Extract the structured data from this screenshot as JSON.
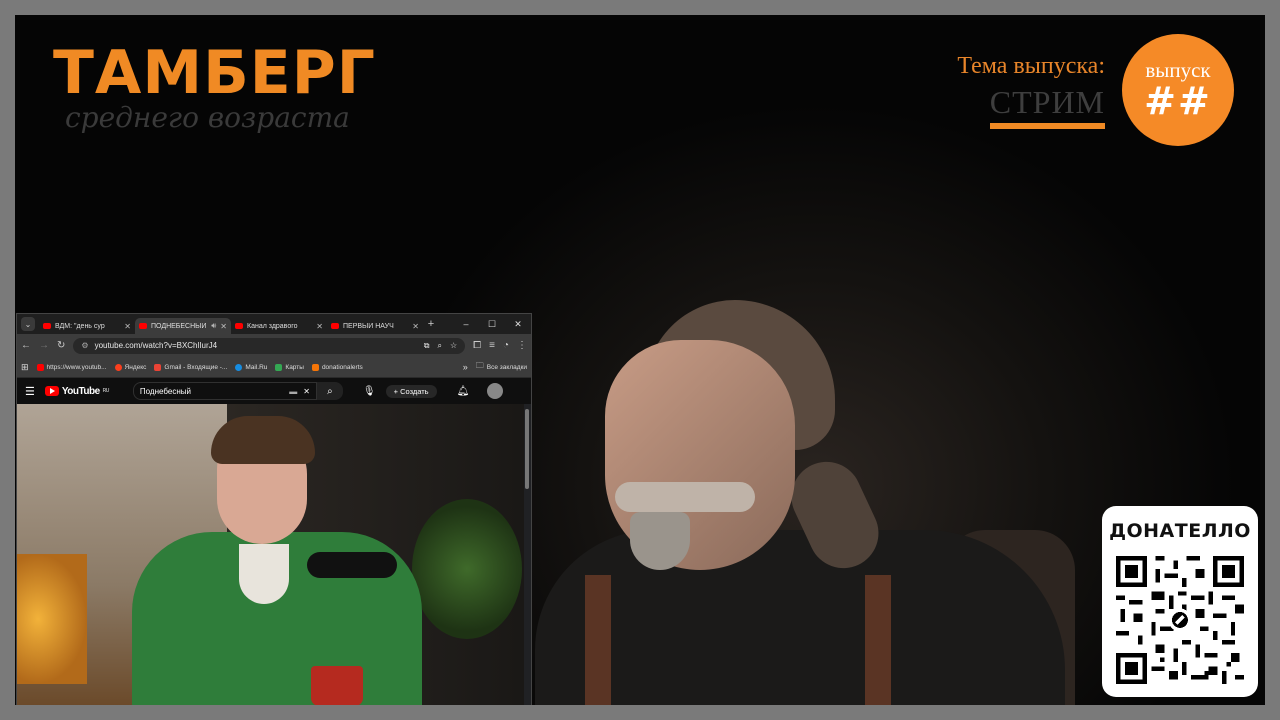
{
  "overlay": {
    "brand_title": "ТАМБЕРГ",
    "brand_subtitle": "среднего возраста",
    "topic_label": "Тема выпуска:",
    "topic_value": "СТРИМ",
    "episode_label": "выпуск",
    "episode_number": "##",
    "donate_title": "ДОНАТЕЛЛО",
    "accent_color": "#f58a27"
  },
  "browser": {
    "tabs": [
      {
        "label": "ВДМ: \"день сур",
        "icon": "youtube-icon",
        "active": false
      },
      {
        "label": "ПОДНЕБЕСНЫЙ",
        "icon": "youtube-icon",
        "active": true
      },
      {
        "label": "Канал здравого",
        "icon": "youtube-icon",
        "active": false
      },
      {
        "label": "ПЕРВЫЙ НАУЧ",
        "icon": "youtube-icon",
        "active": false
      }
    ],
    "new_tab_label": "+",
    "window_buttons": {
      "minimize": "–",
      "maximize": "☐",
      "close": "✕"
    },
    "url": "youtube.com/watch?v=BXChlIurJ4",
    "bookmarks": [
      {
        "label": "https://www.youtub...",
        "color": "#ff0000"
      },
      {
        "label": "Яндекс",
        "color": "#fc3f1d"
      },
      {
        "label": "Gmail - Входящие -...",
        "color": "#ea4335"
      },
      {
        "label": "Mail.Ru",
        "color": "#168de2"
      },
      {
        "label": "Карты",
        "color": "#34a853"
      },
      {
        "label": "donationalerts",
        "color": "#f57507"
      }
    ],
    "bookmarks_overflow": "»",
    "all_bookmarks_label": "Все закладки"
  },
  "youtube": {
    "logo_text": "YouTube",
    "region": "RU",
    "search_query": "Поднебесный",
    "create_label": "Создать"
  }
}
